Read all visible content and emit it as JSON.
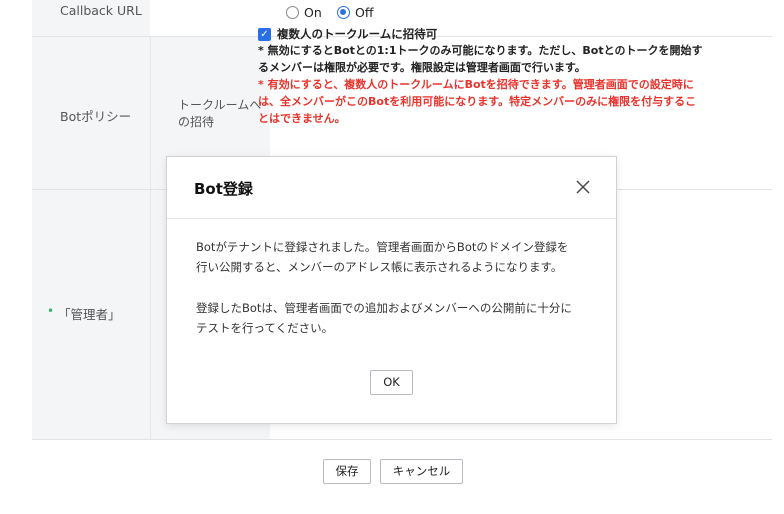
{
  "callback": {
    "label": "Callback URL",
    "options": [
      {
        "label": "On",
        "selected": false
      },
      {
        "label": "Off",
        "selected": true
      }
    ]
  },
  "policy": {
    "label": "Botポリシー",
    "sub_label_line1": "トークルームへ",
    "sub_label_line2": "の招待",
    "checkbox_label": "複数人のトークルームに招待可",
    "checkbox_checked": true,
    "note_line1": "* 無効にするとBotとの1:1トークのみ可能になります。ただし、Botとのトークを開始す",
    "note_line2": "るメンバーは権限が必要です。権限設定は管理者画面で行います。",
    "red_note_line1": "* 有効にすると、複数人のトークルームにBotを招待できます。管理者画面での設定時に",
    "red_note_line2": "は、全メンバーがこのBotを利用可能になります。特定メンバーのみに権限を付与するこ",
    "red_note_line3": "とはできません。"
  },
  "admin": {
    "bullet": "•",
    "label": "「管理者」"
  },
  "modal": {
    "title": "Bot登録",
    "paragraph1_line1": "Botがテナントに登録されました。管理者画面からBotのドメイン登録を",
    "paragraph1_line2": "行い公開すると、メンバーのアドレス帳に表示されるようになります。",
    "paragraph2_line1": "登録したBotは、管理者画面での追加およびメンバーへの公開前に十分に",
    "paragraph2_line2": "テストを行ってください。",
    "ok_label": "OK"
  },
  "footer": {
    "save_label": "保存",
    "cancel_label": "キャンセル"
  },
  "colors": {
    "accent": "#2a6ee8",
    "warning_text": "#e8342c",
    "admin_bullet": "#3cb371"
  }
}
